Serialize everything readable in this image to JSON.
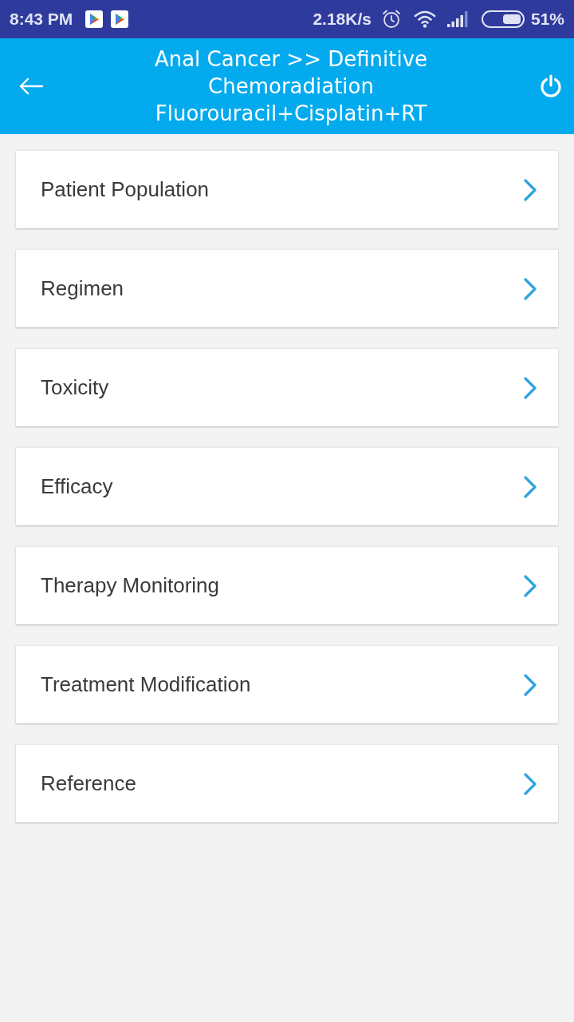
{
  "status_bar": {
    "time": "8:43 PM",
    "network_speed": "2.18K/s",
    "battery": "51%"
  },
  "header": {
    "title": "Anal Cancer >> Definitive Chemoradiation Fluorouracil+Cisplatin+RT"
  },
  "menu_items": [
    {
      "label": "Patient Population"
    },
    {
      "label": "Regimen"
    },
    {
      "label": "Toxicity"
    },
    {
      "label": "Efficacy"
    },
    {
      "label": "Therapy Monitoring"
    },
    {
      "label": "Treatment Modification"
    },
    {
      "label": "Reference"
    }
  ]
}
